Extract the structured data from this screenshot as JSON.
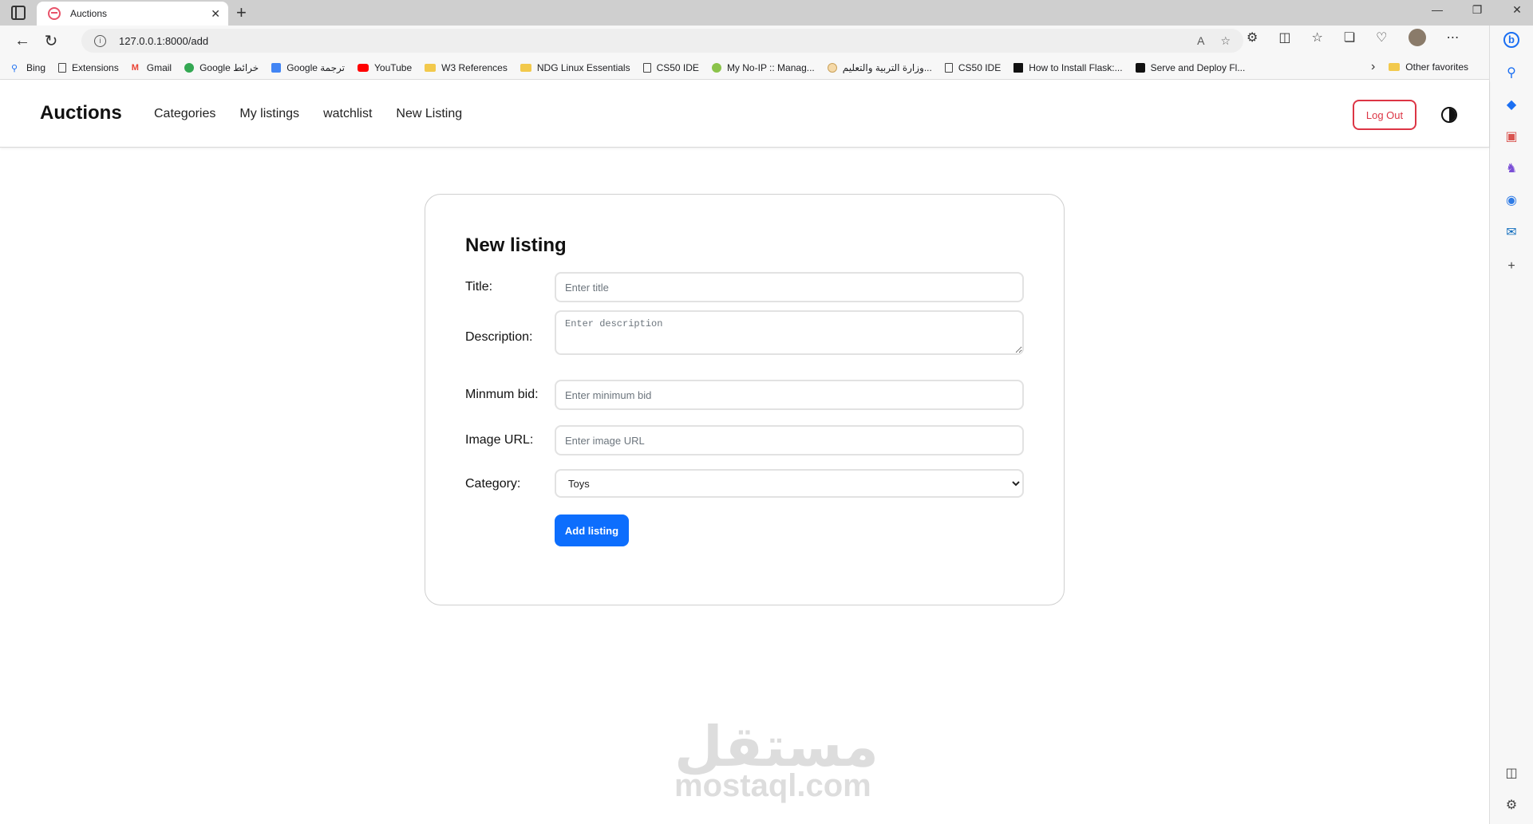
{
  "browser": {
    "tab_title": "Auctions",
    "url": "127.0.0.1:8000/add",
    "bookmarks": [
      {
        "label": "Bing",
        "icon": "search-icon"
      },
      {
        "label": "Extensions",
        "icon": "page-icon"
      },
      {
        "label": "Gmail",
        "icon": "gmail-icon"
      },
      {
        "label": "Google خرائط",
        "icon": "maps-icon"
      },
      {
        "label": "Google ترجمة",
        "icon": "translate-icon"
      },
      {
        "label": "YouTube",
        "icon": "youtube-icon"
      },
      {
        "label": "W3 References",
        "icon": "folder-icon"
      },
      {
        "label": "NDG Linux Essentials",
        "icon": "folder-icon"
      },
      {
        "label": "CS50 IDE",
        "icon": "page-icon"
      },
      {
        "label": "My No-IP :: Manag...",
        "icon": "noip-icon"
      },
      {
        "label": "وزارة التربية والتعليم...",
        "icon": "ministry-icon"
      },
      {
        "label": "CS50 IDE",
        "icon": "page-icon"
      },
      {
        "label": "How to Install Flask:...",
        "icon": "dev-icon"
      },
      {
        "label": "Serve and Deploy Fl...",
        "icon": "medium-icon"
      }
    ],
    "other_favorites": "Other favorites"
  },
  "site": {
    "brand": "Auctions",
    "nav": [
      "Categories",
      "My listings",
      "watchlist",
      "New Listing"
    ],
    "logout_label": "Log Out"
  },
  "form": {
    "heading": "New listing",
    "title_label": "Title:",
    "title_placeholder": "Enter title",
    "description_label": "Description:",
    "description_placeholder": "Enter description",
    "bid_label": "Minmum bid:",
    "bid_placeholder": "Enter minimum bid",
    "image_label": "Image URL:",
    "image_placeholder": "Enter image URL",
    "category_label": "Category:",
    "category_selected": "Toys",
    "submit_label": "Add listing"
  },
  "watermark": {
    "arabic": "مستقل",
    "latin": "mostaql.com"
  },
  "colors": {
    "primary": "#0d6efd",
    "danger": "#dc3545"
  }
}
